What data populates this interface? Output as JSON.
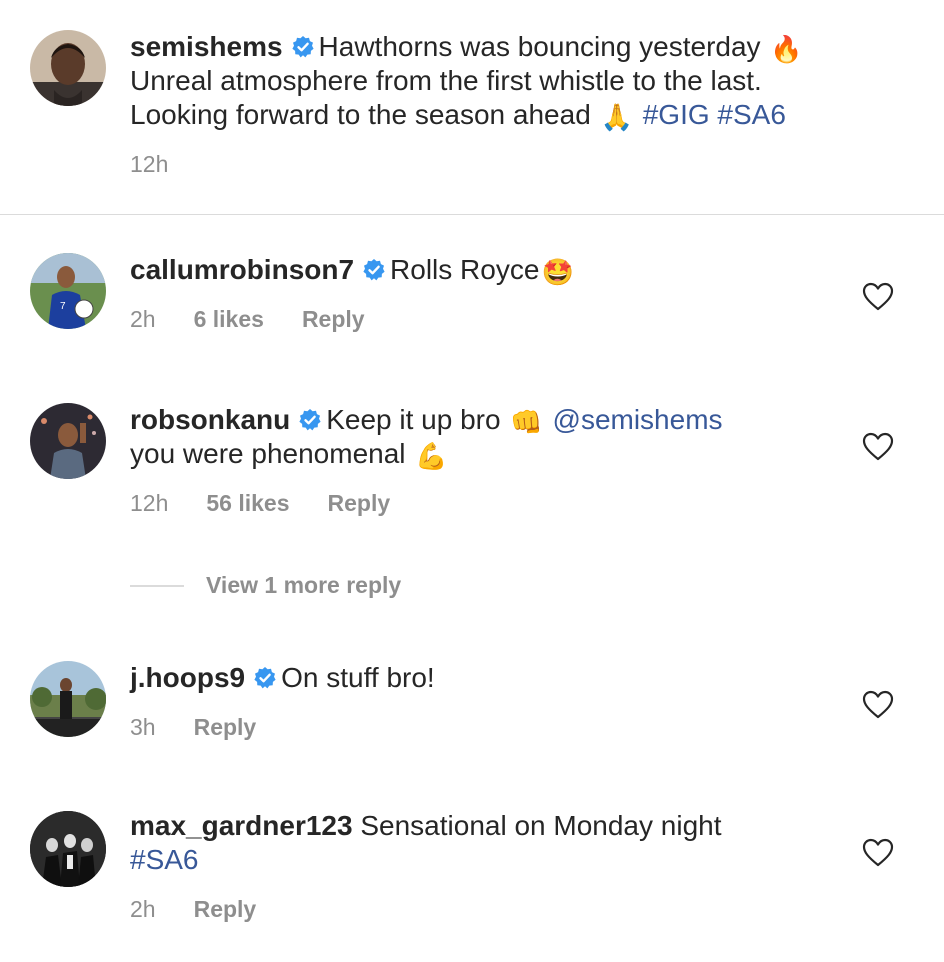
{
  "caption": {
    "username": "semishems",
    "line1": "Hawthorns was bouncing yesterday",
    "emoji1": "🔥",
    "line2": "Unreal atmosphere from the first whistle to the last.",
    "line3": "Looking forward to the season ahead",
    "emoji2": "🙏",
    "hashtags": "#GIG #SA6",
    "time": "12h"
  },
  "comments": [
    {
      "username": "callumrobinson7",
      "text": "Rolls Royce",
      "emoji": "🤩",
      "time": "2h",
      "likes": "6 likes",
      "reply": "Reply"
    },
    {
      "username": "robsonkanu",
      "text": "Keep it up bro",
      "emoji": "👊",
      "mention": "@semishems",
      "text2": "you were phenomenal",
      "emoji2": "💪",
      "time": "12h",
      "likes": "56 likes",
      "reply": "Reply",
      "view_more": "View 1 more reply"
    },
    {
      "username": "j.hoops9",
      "text": "On stuff bro!",
      "time": "3h",
      "reply": "Reply"
    },
    {
      "username": "max_gardner123",
      "text": "Sensational on Monday night",
      "hashtag": "#SA6",
      "time": "2h",
      "reply": "Reply"
    }
  ],
  "colors": {
    "text": "#262626",
    "meta": "#8e8e8e",
    "link": "#385898",
    "verified": "#3897f0",
    "divider": "#dbdbdb"
  }
}
